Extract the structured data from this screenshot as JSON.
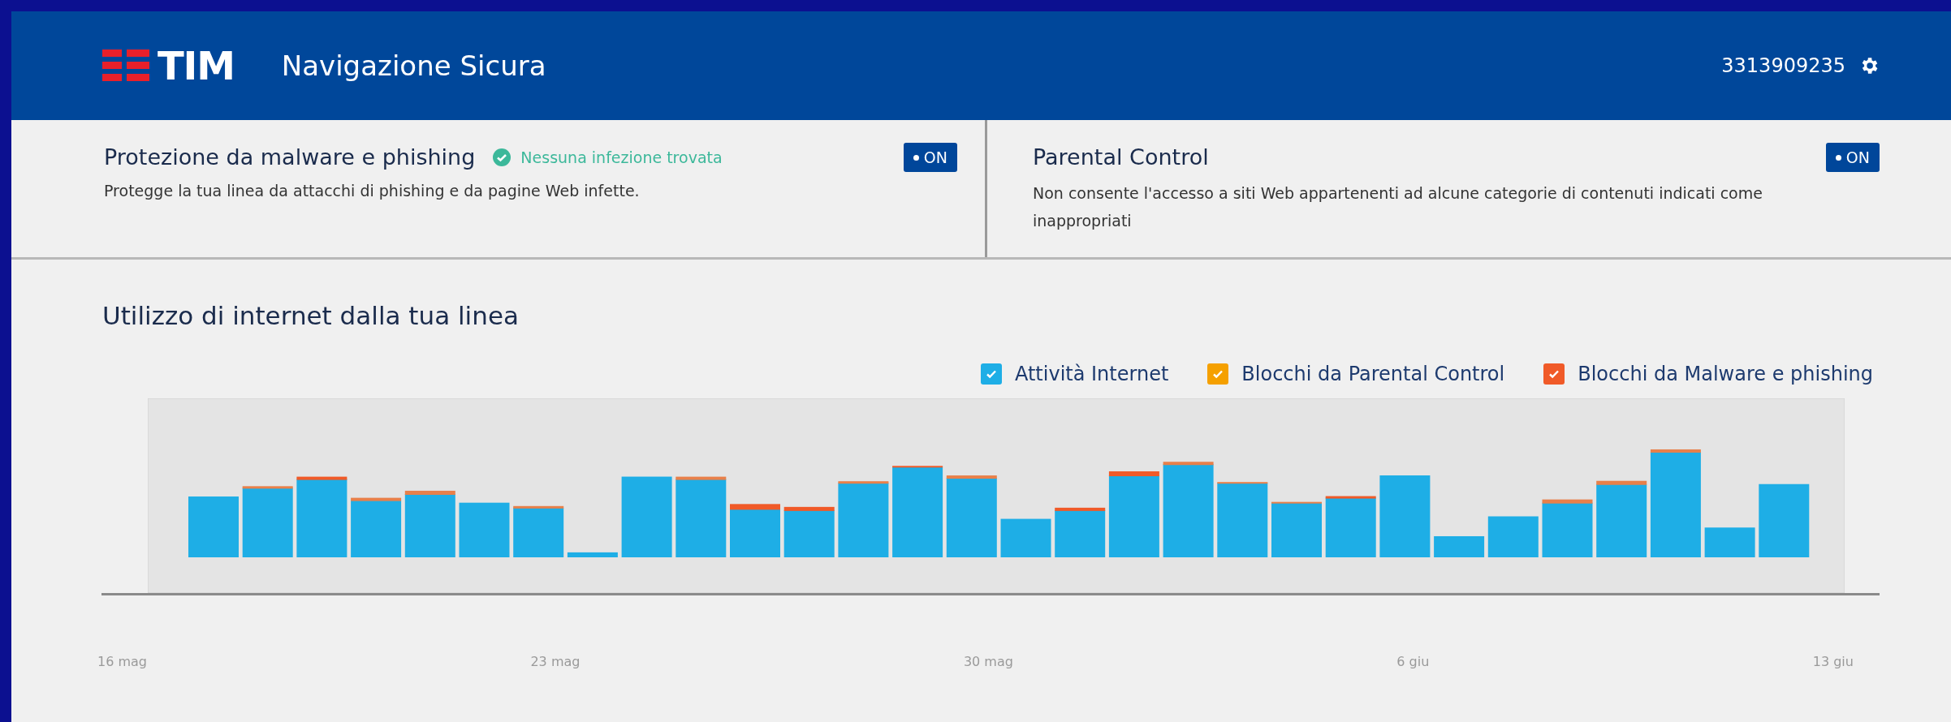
{
  "header": {
    "logo": "TIM",
    "title": "Navigazione Sicura",
    "account": "3313909235"
  },
  "services": [
    {
      "title": "Protezione da malware e phishing",
      "status": "Nessuna infezione trovata",
      "description": "Protegge la tua linea da attacchi di phishing e da pagine Web infette.",
      "toggle": "ON",
      "on": true
    },
    {
      "title": "Parental Control",
      "description": "Non consente l'accesso a siti Web appartenenti ad alcune categorie di contenuti indicati come inappropriati",
      "toggle": "ON",
      "on": true
    }
  ],
  "usage": {
    "title": "Utilizzo di internet dalla tua linea",
    "legend": [
      {
        "label": "Attività Internet",
        "checked": true,
        "color": "#1eaee6"
      },
      {
        "label": "Blocchi da Parental Control",
        "checked": true,
        "color": "#f5a000"
      },
      {
        "label": "Blocchi da Malware e phishing",
        "checked": true,
        "color": "#f05a28"
      }
    ],
    "dates": [
      "16 mag",
      "23 mag",
      "30 mag",
      "6 giu",
      "13 giu"
    ]
  }
}
